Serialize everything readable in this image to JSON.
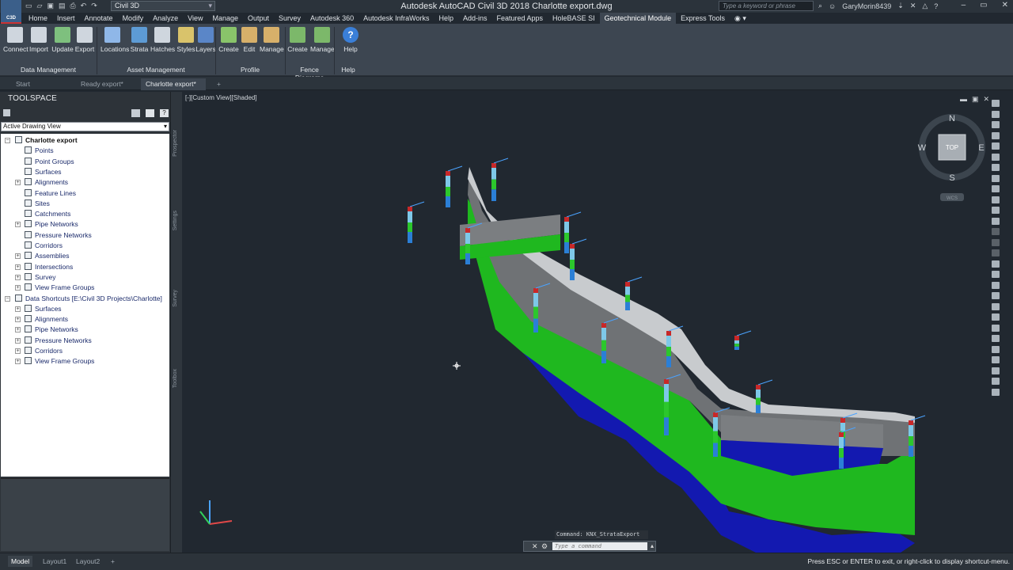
{
  "app": {
    "title": "Autodesk AutoCAD Civil 3D 2018    Charlotte export.dwg",
    "logo": "C3D",
    "workspace": "Civil 3D",
    "search_placeholder": "Type a keyword or phrase",
    "user": "GaryMorin8439"
  },
  "menu_tabs": [
    "Home",
    "Insert",
    "Annotate",
    "Modify",
    "Analyze",
    "View",
    "Manage",
    "Output",
    "Survey",
    "Autodesk 360",
    "Autodesk InfraWorks",
    "Help",
    "Add-ins",
    "Featured Apps",
    "HoleBASE SI",
    "Geotechnical Module",
    "Express Tools"
  ],
  "active_tab": "Geotechnical Module",
  "ribbon": {
    "buttons": [
      "Connect",
      "Import",
      "Update",
      "Export",
      "Locations",
      "Strata",
      "Hatches",
      "Styles",
      "Layers",
      "Create",
      "Edit",
      "Manage",
      "Create",
      "Manage",
      "Help"
    ],
    "panels": [
      "Data Management",
      "Asset Management",
      "Profile",
      "Fence Diagrams",
      "Help"
    ]
  },
  "doc_tabs": [
    "Start",
    "Ready export*",
    "Charlotte export*"
  ],
  "toolspace": {
    "title": "TOOLSPACE",
    "view_select": "Active Drawing View",
    "tree": [
      "Charlotte export",
      "Points",
      "Point Groups",
      "Surfaces",
      "Alignments",
      "Feature Lines",
      "Sites",
      "Catchments",
      "Pipe Networks",
      "Pressure Networks",
      "Corridors",
      "Assemblies",
      "Intersections",
      "Survey",
      "View Frame Groups",
      "Data Shortcuts [E:\\Civil 3D Projects\\Charlotte]",
      "Surfaces",
      "Alignments",
      "Pipe Networks",
      "Pressure Networks",
      "Corridors",
      "View Frame Groups"
    ],
    "side_tabs": [
      "Prospector",
      "Settings",
      "Survey",
      "Toolbox"
    ]
  },
  "viewport": {
    "label": "[-][Custom View][Shaded]",
    "viewcube": {
      "top": "TOP",
      "n": "N",
      "s": "S",
      "e": "E",
      "w": "W",
      "wcs": "WCS"
    },
    "command_log": "Command: KNX_StrataExport",
    "command_placeholder": "Type a command"
  },
  "status": {
    "layout_tabs": [
      "Model",
      "Layout1",
      "Layout2"
    ],
    "prompt": "Press ESC or ENTER to exit, or right-click to display shortcut-menu."
  }
}
